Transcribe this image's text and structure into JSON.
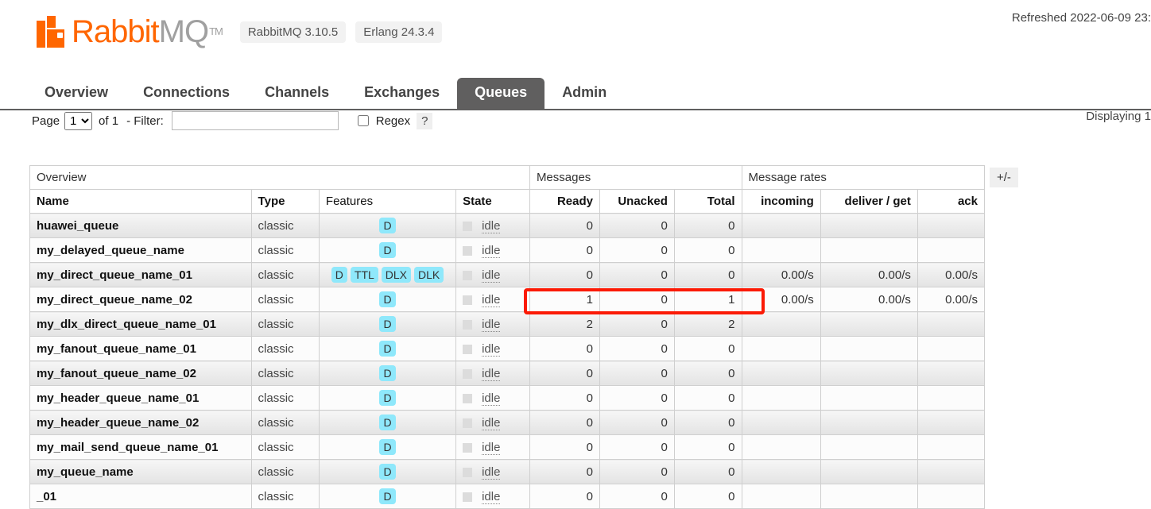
{
  "header": {
    "refreshed": "Refreshed 2022-06-09 23:",
    "logo_rabbit": "Rabbit",
    "logo_mq": "MQ",
    "logo_tm": "TM",
    "version_rabbitmq": "RabbitMQ 3.10.5",
    "version_erlang": "Erlang 24.3.4",
    "brand_color": "#ff6600"
  },
  "nav": {
    "tabs": [
      {
        "label": "Overview",
        "active": false
      },
      {
        "label": "Connections",
        "active": false
      },
      {
        "label": "Channels",
        "active": false
      },
      {
        "label": "Exchanges",
        "active": false
      },
      {
        "label": "Queues",
        "active": true
      },
      {
        "label": "Admin",
        "active": false
      }
    ],
    "active_tab_bg": "#605f5f"
  },
  "filterbar": {
    "page_label": "Page",
    "page_value": "1",
    "page_options": [
      "1"
    ],
    "of_label": "of 1",
    "filter_label": "- Filter:",
    "filter_value": "",
    "filter_placeholder": "",
    "regex_label": "Regex",
    "regex_checked": false,
    "help_label": "?",
    "displaying": "Displaying 1"
  },
  "table": {
    "group_headers": [
      {
        "label": "Overview",
        "colspan": 4
      },
      {
        "label": "Messages",
        "colspan": 3
      },
      {
        "label": "Message rates",
        "colspan": 3
      }
    ],
    "columns": [
      {
        "label": "Name",
        "bold": true,
        "align": "left"
      },
      {
        "label": "Type",
        "bold": true,
        "align": "left"
      },
      {
        "label": "Features",
        "bold": false,
        "align": "left"
      },
      {
        "label": "State",
        "bold": true,
        "align": "left"
      },
      {
        "label": "Ready",
        "bold": true,
        "align": "right"
      },
      {
        "label": "Unacked",
        "bold": true,
        "align": "right"
      },
      {
        "label": "Total",
        "bold": true,
        "align": "right"
      },
      {
        "label": "incoming",
        "bold": true,
        "align": "right"
      },
      {
        "label": "deliver / get",
        "bold": true,
        "align": "right"
      },
      {
        "label": "ack",
        "bold": true,
        "align": "right"
      }
    ],
    "plus_minus_label": "+/-",
    "feature_badge_color": "#8fe8fb",
    "rows": [
      {
        "name": "huawei_queue",
        "type": "classic",
        "features": [
          "D"
        ],
        "state": "idle",
        "ready": "0",
        "unacked": "0",
        "total": "0",
        "incoming": "",
        "deliver_get": "",
        "ack": ""
      },
      {
        "name": "my_delayed_queue_name",
        "type": "classic",
        "features": [
          "D"
        ],
        "state": "idle",
        "ready": "0",
        "unacked": "0",
        "total": "0",
        "incoming": "",
        "deliver_get": "",
        "ack": ""
      },
      {
        "name": "my_direct_queue_name_01",
        "type": "classic",
        "features": [
          "D",
          "TTL",
          "DLX",
          "DLK"
        ],
        "state": "idle",
        "ready": "0",
        "unacked": "0",
        "total": "0",
        "incoming": "0.00/s",
        "deliver_get": "0.00/s",
        "ack": "0.00/s"
      },
      {
        "name": "my_direct_queue_name_02",
        "type": "classic",
        "features": [
          "D"
        ],
        "state": "idle",
        "ready": "1",
        "unacked": "0",
        "total": "1",
        "incoming": "0.00/s",
        "deliver_get": "0.00/s",
        "ack": "0.00/s"
      },
      {
        "name": "my_dlx_direct_queue_name_01",
        "type": "classic",
        "features": [
          "D"
        ],
        "state": "idle",
        "ready": "2",
        "unacked": "0",
        "total": "2",
        "incoming": "",
        "deliver_get": "",
        "ack": ""
      },
      {
        "name": "my_fanout_queue_name_01",
        "type": "classic",
        "features": [
          "D"
        ],
        "state": "idle",
        "ready": "0",
        "unacked": "0",
        "total": "0",
        "incoming": "",
        "deliver_get": "",
        "ack": ""
      },
      {
        "name": "my_fanout_queue_name_02",
        "type": "classic",
        "features": [
          "D"
        ],
        "state": "idle",
        "ready": "0",
        "unacked": "0",
        "total": "0",
        "incoming": "",
        "deliver_get": "",
        "ack": ""
      },
      {
        "name": "my_header_queue_name_01",
        "type": "classic",
        "features": [
          "D"
        ],
        "state": "idle",
        "ready": "0",
        "unacked": "0",
        "total": "0",
        "incoming": "",
        "deliver_get": "",
        "ack": ""
      },
      {
        "name": "my_header_queue_name_02",
        "type": "classic",
        "features": [
          "D"
        ],
        "state": "idle",
        "ready": "0",
        "unacked": "0",
        "total": "0",
        "incoming": "",
        "deliver_get": "",
        "ack": ""
      },
      {
        "name": "my_mail_send_queue_name_01",
        "type": "classic",
        "features": [
          "D"
        ],
        "state": "idle",
        "ready": "0",
        "unacked": "0",
        "total": "0",
        "incoming": "",
        "deliver_get": "",
        "ack": ""
      },
      {
        "name": "my_queue_name",
        "type": "classic",
        "features": [
          "D"
        ],
        "state": "idle",
        "ready": "0",
        "unacked": "0",
        "total": "0",
        "incoming": "",
        "deliver_get": "",
        "ack": ""
      },
      {
        "name": "_01",
        "type": "classic",
        "features": [
          "D"
        ],
        "state": "idle",
        "ready": "0",
        "unacked": "0",
        "total": "0",
        "incoming": "",
        "deliver_get": "",
        "ack": ""
      }
    ]
  },
  "annotation": {
    "color": "#fb1a05",
    "target_row": "my_direct_queue_name_02",
    "target_columns": [
      "Ready",
      "Unacked",
      "Total"
    ]
  }
}
